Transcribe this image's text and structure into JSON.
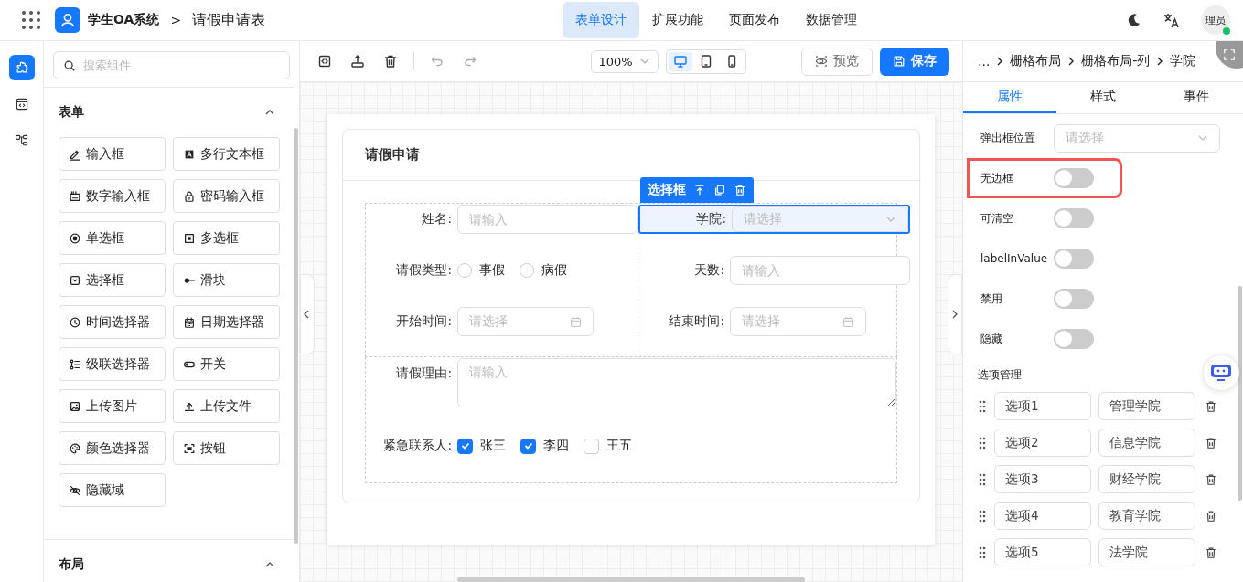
{
  "header": {
    "app_name": "学生OA系统",
    "separator": ">",
    "page_title": "请假申请表",
    "nav": [
      {
        "label": "表单设计",
        "selected": true
      },
      {
        "label": "扩展功能",
        "selected": false
      },
      {
        "label": "页面发布",
        "selected": false
      },
      {
        "label": "数据管理",
        "selected": false
      }
    ],
    "user": {
      "name": "理员",
      "online": true
    }
  },
  "icon_strip": [
    {
      "kind": "components",
      "selected": true
    },
    {
      "kind": "code",
      "selected": false
    },
    {
      "kind": "tree",
      "selected": false
    }
  ],
  "components_panel": {
    "search": {
      "placeholder": "搜索组件"
    },
    "sections": [
      {
        "title": "表单",
        "expanded": true,
        "items": [
          {
            "kind": "input",
            "label": "输入框"
          },
          {
            "kind": "textarea",
            "label": "多行文本框"
          },
          {
            "kind": "number",
            "label": "数字输入框"
          },
          {
            "kind": "password",
            "label": "密码输入框"
          },
          {
            "kind": "radio",
            "label": "单选框"
          },
          {
            "kind": "checkbox",
            "label": "多选框"
          },
          {
            "kind": "select",
            "label": "选择框"
          },
          {
            "kind": "slider",
            "label": "滑块"
          },
          {
            "kind": "time",
            "label": "时间选择器"
          },
          {
            "kind": "date",
            "label": "日期选择器"
          },
          {
            "kind": "cascader",
            "label": "级联选择器"
          },
          {
            "kind": "switch",
            "label": "开关"
          },
          {
            "kind": "image",
            "label": "上传图片"
          },
          {
            "kind": "upload",
            "label": "上传文件"
          },
          {
            "kind": "color",
            "label": "颜色选择器"
          },
          {
            "kind": "button",
            "label": "按钮"
          },
          {
            "kind": "hidden",
            "label": "隐藏域"
          }
        ]
      },
      {
        "title": "布局",
        "expanded": true
      }
    ]
  },
  "toolbar": {
    "zoom": "100%",
    "devices": [
      {
        "kind": "desktop",
        "selected": true
      },
      {
        "kind": "tablet",
        "selected": false
      },
      {
        "kind": "phone",
        "selected": false
      }
    ],
    "preview": "预览",
    "save": "保存"
  },
  "form": {
    "title": "请假申请",
    "selected_toolbar": {
      "label": "选择框"
    },
    "fields": [
      {
        "kind": "input",
        "label": "姓名:",
        "placeholder": "请输入",
        "selected": false
      },
      {
        "kind": "select",
        "label": "学院:",
        "placeholder": "请选择",
        "selected": true
      },
      {
        "kind": "radio",
        "label": "请假类型:",
        "options": [
          {
            "label": "事假",
            "checked": false
          },
          {
            "label": "病假",
            "checked": false
          }
        ],
        "selected": false
      },
      {
        "kind": "input",
        "label": "天数:",
        "placeholder": "请输入",
        "selected": false
      },
      {
        "kind": "date",
        "label": "开始时间:",
        "placeholder": "请选择",
        "selected": false
      },
      {
        "kind": "date",
        "label": "结束时间:",
        "placeholder": "请选择",
        "selected": false
      }
    ],
    "reason": {
      "label": "请假理由:",
      "placeholder": "请输入"
    },
    "contacts": {
      "label": "紧急联系人:",
      "options": [
        {
          "label": "张三",
          "checked": true
        },
        {
          "label": "李四",
          "checked": true
        },
        {
          "label": "王五",
          "checked": false
        }
      ]
    }
  },
  "properties_panel": {
    "breadcrumb": [
      "...",
      "栅格布局",
      "栅格布局-列",
      "学院"
    ],
    "tabs": [
      {
        "label": "属性",
        "selected": true
      },
      {
        "label": "样式",
        "selected": false
      },
      {
        "label": "事件",
        "selected": false
      }
    ],
    "props": [
      {
        "kind": "select",
        "label": "弹出框位置",
        "placeholder": "请选择",
        "highlighted": false
      },
      {
        "kind": "switch",
        "label": "无边框",
        "on": false,
        "highlighted": true
      },
      {
        "kind": "switch",
        "label": "可清空",
        "on": false,
        "highlighted": false
      },
      {
        "kind": "switch",
        "label": "labelInValue",
        "on": false,
        "highlighted": false
      },
      {
        "kind": "switch",
        "label": "禁用",
        "on": false,
        "highlighted": false
      },
      {
        "kind": "switch",
        "label": "隐藏",
        "on": false,
        "highlighted": false
      }
    ],
    "options_title": "选项管理",
    "options": [
      {
        "key": "选项1",
        "value": "管理学院"
      },
      {
        "key": "选项2",
        "value": "信息学院"
      },
      {
        "key": "选项3",
        "value": "财经学院"
      },
      {
        "key": "选项4",
        "value": "教育学院"
      },
      {
        "key": "选项5",
        "value": "法学院"
      }
    ]
  }
}
